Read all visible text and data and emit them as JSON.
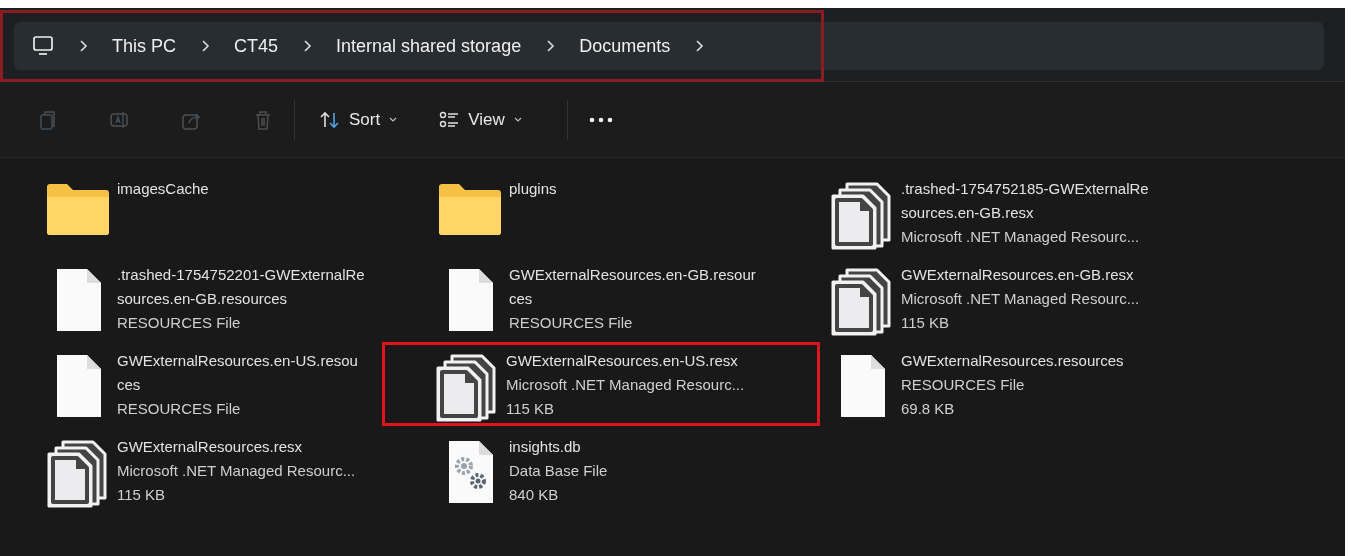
{
  "address_bar": {
    "highlighted": true,
    "crumbs": [
      "This PC",
      "CT45",
      "Internal shared storage",
      "Documents"
    ]
  },
  "toolbar": {
    "actions": [
      {
        "kind": "copy",
        "disabled": true
      },
      {
        "kind": "rename",
        "disabled": true
      },
      {
        "kind": "share",
        "disabled": true
      },
      {
        "kind": "delete",
        "disabled": true
      }
    ],
    "menus": [
      {
        "kind": "sort",
        "label": "Sort"
      },
      {
        "kind": "view",
        "label": "View"
      }
    ]
  },
  "items": [
    {
      "kind": "folder",
      "name_lines": [
        "imagesCache"
      ],
      "highlighted": false
    },
    {
      "kind": "folder",
      "name_lines": [
        "plugins"
      ],
      "highlighted": false
    },
    {
      "kind": "resx",
      "name_lines": [
        ".trashed-1754752185-GWExternalRe",
        "sources.en-GB.resx"
      ],
      "type": "Microsoft .NET Managed Resourc...",
      "highlighted": false
    },
    {
      "kind": "file",
      "name_lines": [
        ".trashed-1754752201-GWExternalRe",
        "sources.en-GB.resources"
      ],
      "type": "RESOURCES File",
      "highlighted": false
    },
    {
      "kind": "file",
      "name_lines": [
        "GWExternalResources.en-GB.resour",
        "ces"
      ],
      "type": "RESOURCES File",
      "highlighted": false
    },
    {
      "kind": "resx",
      "name_lines": [
        "GWExternalResources.en-GB.resx"
      ],
      "type": "Microsoft .NET Managed Resourc...",
      "size": "115 KB",
      "highlighted": false
    },
    {
      "kind": "file",
      "name_lines": [
        "GWExternalResources.en-US.resou",
        "ces"
      ],
      "type": "RESOURCES File",
      "highlighted": false
    },
    {
      "kind": "resx",
      "name_lines": [
        "GWExternalResources.en-US.resx"
      ],
      "type": "Microsoft .NET Managed Resourc...",
      "size": "115 KB",
      "highlighted": true
    },
    {
      "kind": "file",
      "name_lines": [
        "GWExternalResources.resources"
      ],
      "type": "RESOURCES File",
      "size": "69.8 KB",
      "highlighted": false
    },
    {
      "kind": "resx",
      "name_lines": [
        "GWExternalResources.resx"
      ],
      "type": "Microsoft .NET Managed Resourc...",
      "size": "115 KB",
      "highlighted": false
    },
    {
      "kind": "db",
      "name_lines": [
        "insights.db"
      ],
      "type": "Data Base File",
      "size": "840 KB",
      "highlighted": false
    }
  ]
}
